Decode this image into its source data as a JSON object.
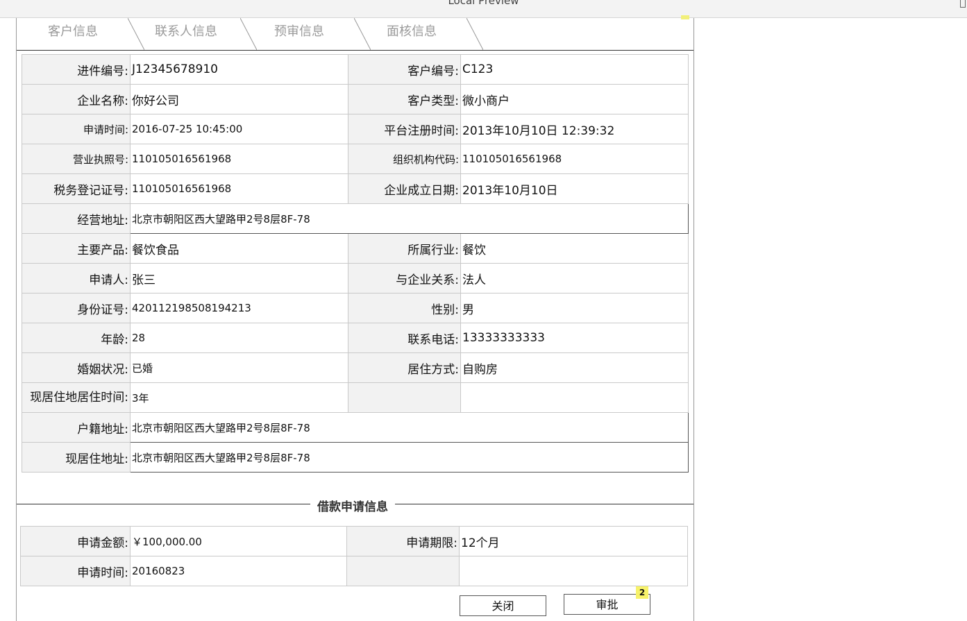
{
  "window": {
    "title": "Local Preview"
  },
  "tabs": [
    {
      "label": "客户信息"
    },
    {
      "label": "联系人信息"
    },
    {
      "label": "预审信息"
    },
    {
      "label": "面核信息"
    }
  ],
  "customer": {
    "case_no_label": "进件编号:",
    "case_no": "J12345678910",
    "customer_no_label": "客户编号:",
    "customer_no": "C123",
    "company_label": "企业名称:",
    "company": "你好公司",
    "customer_type_label": "客户类型:",
    "customer_type": "微小商户",
    "apply_time_label": "申请时间:",
    "apply_time": "2016-07-25 10:45:00",
    "register_time_label": "平台注册时间:",
    "register_time": "2013年10月10日 12:39:32",
    "license_label": "营业执照号:",
    "license": "110105016561968",
    "org_code_label": "组织机构代码:",
    "org_code": "110105016561968",
    "tax_label": "税务登记证号:",
    "tax": "110105016561968",
    "founded_label": "企业成立日期:",
    "founded": "2013年10月10日",
    "biz_addr_label": "经营地址:",
    "biz_addr": "北京市朝阳区西大望路甲2号8层8F-78",
    "product_label": "主要产品:",
    "product": "餐饮食品",
    "industry_label": "所属行业:",
    "industry": "餐饮",
    "applicant_label": "申请人:",
    "applicant": "张三",
    "relation_label": "与企业关系:",
    "relation": "法人",
    "id_label": "身份证号:",
    "id": "420112198508194213",
    "gender_label": "性别:",
    "gender": "男",
    "age_label": "年龄:",
    "age": "28",
    "phone_label": "联系电话:",
    "phone": "13333333333",
    "marital_label": "婚姻状况:",
    "marital": "已婚",
    "housing_label": "居住方式:",
    "housing": "自购房",
    "residence_time_label": "现居住地居住时间:",
    "residence_time": "3年",
    "hukou_addr_label": "户籍地址:",
    "hukou_addr": "北京市朝阳区西大望路甲2号8层8F-78",
    "current_addr_label": "现居住地址:",
    "current_addr": "北京市朝阳区西大望路甲2号8层8F-78"
  },
  "loan": {
    "section_title": "借款申请信息",
    "amount_label": "申请金额:",
    "amount": "￥100,000.00",
    "term_label": "申请期限:",
    "term": "12个月",
    "apply_time_label": "申请时间:",
    "apply_time": "20160823"
  },
  "actions": {
    "close_label": "关闭",
    "approve_label": "审批",
    "approve_badge": "2"
  }
}
